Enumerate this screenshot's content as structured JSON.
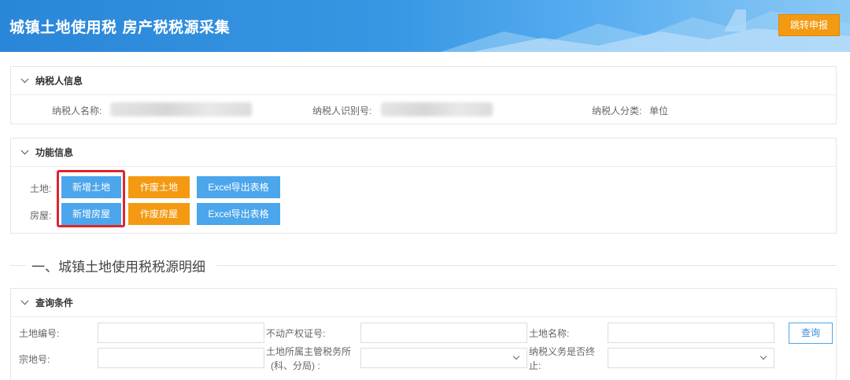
{
  "header": {
    "title": "城镇土地使用税 房产税税源采集",
    "jump_button": "跳转申报"
  },
  "taxpayer_panel": {
    "title": "纳税人信息",
    "name_label": "纳税人名称:",
    "id_label": "纳税人识别号:",
    "category_label": "纳税人分类:",
    "category_value": "单位"
  },
  "function_panel": {
    "title": "功能信息",
    "land_label": "土地:",
    "house_label": "房屋:",
    "add_land": "新增土地",
    "void_land": "作废土地",
    "export_land": "Excel导出表格",
    "add_house": "新增房屋",
    "void_house": "作废房屋",
    "export_house": "Excel导出表格"
  },
  "section": {
    "title": "一、城镇土地使用税税源明细"
  },
  "query_panel": {
    "title": "查询条件",
    "land_no_label": "土地编号:",
    "property_cert_label": "不动产权证号:",
    "land_name_label": "土地名称:",
    "parcel_no_label": "宗地号:",
    "tax_office_label_line1": "土地所属主管税务所",
    "tax_office_label_line2": "(科、分局) :",
    "obligation_label_line1": "纳税义务是否终",
    "obligation_label_line2": "止:",
    "query_button": "查询"
  },
  "colors": {
    "primary_blue": "#4ba6ec",
    "accent_orange": "#f39a12",
    "highlight_red": "#e0262b",
    "header_blue": "#2a86d8"
  }
}
